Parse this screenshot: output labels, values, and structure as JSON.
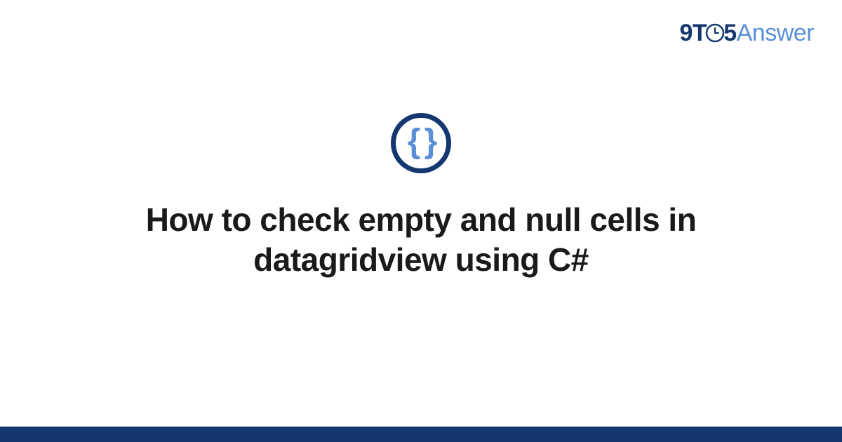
{
  "brand": {
    "nine": "9",
    "t": "T",
    "five": "5",
    "answer": "Answer"
  },
  "logo": {
    "braces": "{ }"
  },
  "title": "How to check empty and null cells in datagridview using C#"
}
